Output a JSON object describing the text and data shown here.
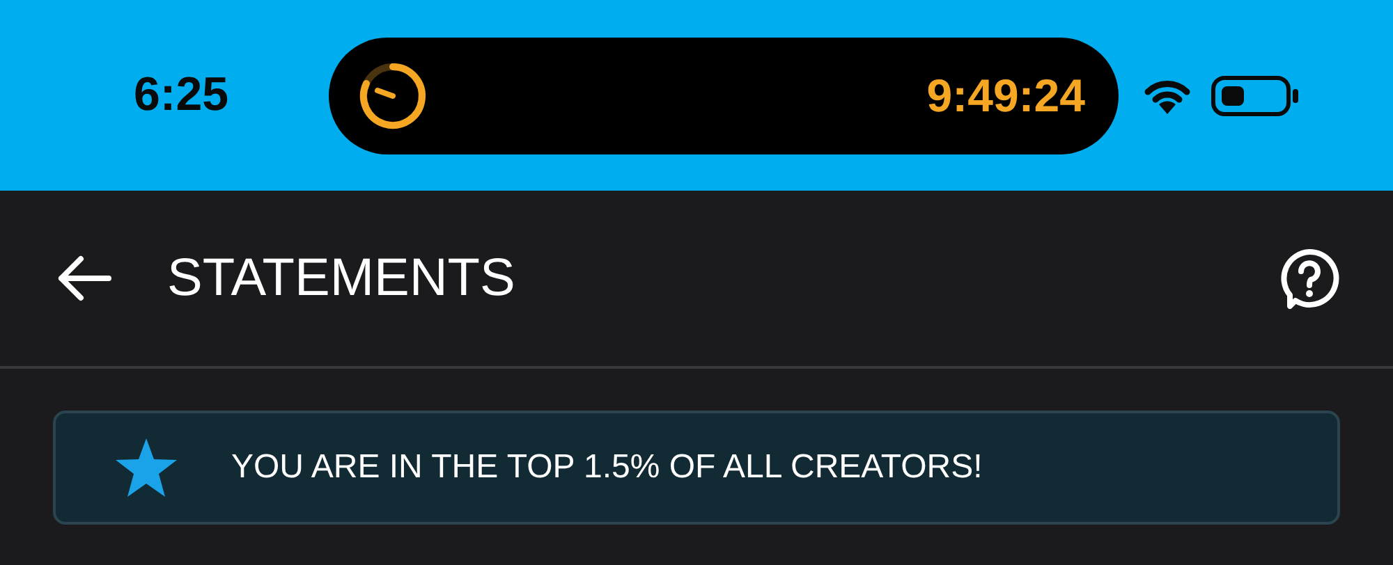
{
  "status_bar": {
    "time": "6:25",
    "timer": "9:49:24"
  },
  "header": {
    "title": "STATEMENTS"
  },
  "banner": {
    "text": "YOU ARE IN THE TOP 1.5% OF ALL CREATORS!"
  }
}
